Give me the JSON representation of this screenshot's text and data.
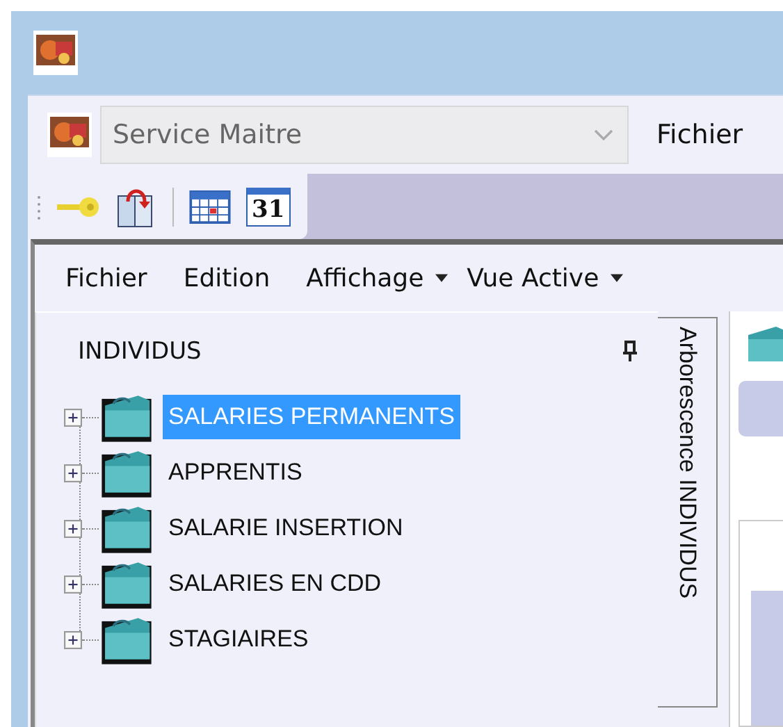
{
  "combo": {
    "value": "Service Maitre"
  },
  "top_menu": [
    "Fichier"
  ],
  "toolbar": [
    {
      "kind": "key"
    },
    {
      "kind": "book"
    },
    {
      "kind": "separator"
    },
    {
      "kind": "calendar"
    },
    {
      "kind": "date",
      "text": "31"
    }
  ],
  "menu": [
    {
      "label": "Fichier",
      "dropdown": false
    },
    {
      "label": "Edition",
      "dropdown": false
    },
    {
      "label": "Affichage",
      "dropdown": true
    },
    {
      "label": "Vue Active",
      "dropdown": true
    }
  ],
  "panel": {
    "title": "INDIVIDUS",
    "side_tab": "Arborescence INDIVIDUS",
    "tree": [
      {
        "label": "SALARIES PERMANENTS",
        "selected": true,
        "expanded": false
      },
      {
        "label": "APPRENTIS",
        "selected": false,
        "expanded": false
      },
      {
        "label": "SALARIE INSERTION",
        "selected": false,
        "expanded": false
      },
      {
        "label": "SALARIES EN CDD",
        "selected": false,
        "expanded": false
      },
      {
        "label": "STAGIAIRES",
        "selected": false,
        "expanded": false
      }
    ]
  }
}
